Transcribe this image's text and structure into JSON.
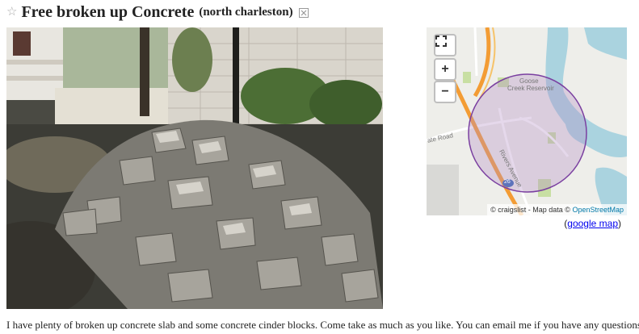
{
  "posting": {
    "title": "Free broken up Concrete",
    "location": "(north charleston)",
    "body": "I have plenty of broken up concrete slab and some concrete cinder blocks. Come take as much as you like. You can email me if you have any questions."
  },
  "icons": {
    "favorite": "star-icon",
    "hide": "hide-icon",
    "fullscreen": "fullscreen-icon"
  },
  "map": {
    "zoom_in_label": "+",
    "zoom_out_label": "−",
    "labels": {
      "reservoir_line1": "Goose",
      "reservoir_line2": "Creek Reservoir",
      "road_left": "ate Road",
      "road_rivers": "Rivers Avenue",
      "highway_shield": "26"
    },
    "attribution_prefix": "© craigslist - Map data ©",
    "attribution_link": "OpenStreetMap",
    "colors": {
      "water": "#aad3df",
      "highway": "#f39c34",
      "circle_fill": "#b58ec6",
      "circle_stroke": "#7a3fa0",
      "park": "#c8dfa3"
    }
  },
  "google_map": {
    "open_paren": "(",
    "link_text": "google map",
    "close_paren": ")"
  }
}
